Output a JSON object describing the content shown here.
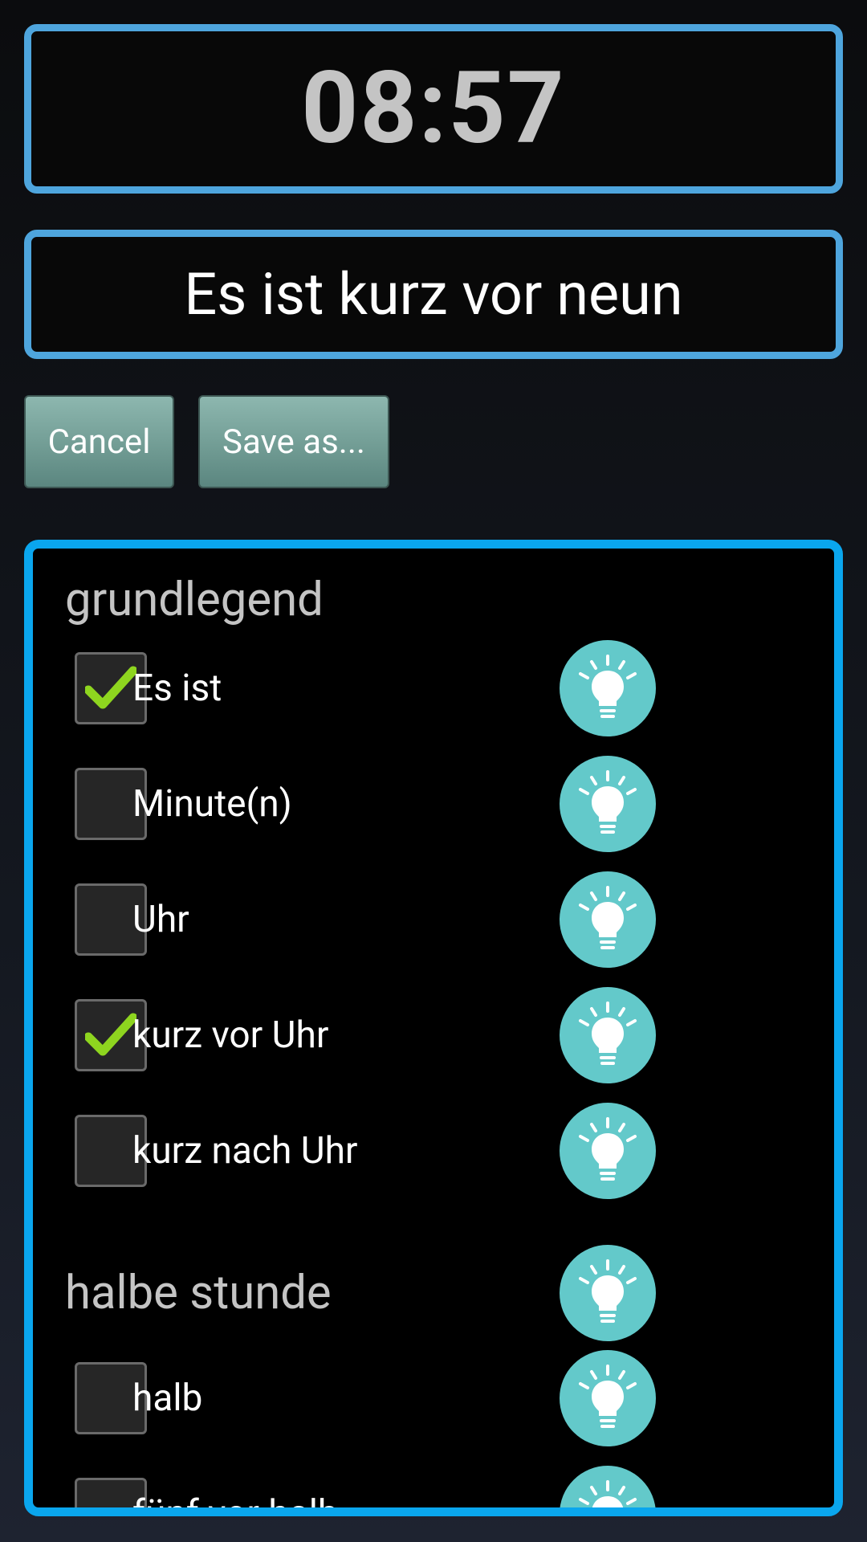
{
  "clock": {
    "time": "08:57"
  },
  "phrase": {
    "text": "Es ist kurz vor neun"
  },
  "buttons": {
    "cancel": "Cancel",
    "save_as": "Save as..."
  },
  "sections": [
    {
      "title": "grundlegend",
      "items": [
        {
          "label": "Es ist",
          "checked": true,
          "icon": "lightbulb-icon"
        },
        {
          "label": "Minute(n)",
          "checked": false,
          "icon": "lightbulb-icon"
        },
        {
          "label": "Uhr",
          "checked": false,
          "icon": "lightbulb-icon"
        },
        {
          "label": "kurz vor Uhr",
          "checked": true,
          "icon": "lightbulb-icon"
        },
        {
          "label": "kurz nach Uhr",
          "checked": false,
          "icon": "lightbulb-icon"
        }
      ]
    },
    {
      "title": "halbe stunde",
      "title_icon": "lightbulb-icon",
      "items": [
        {
          "label": "halb",
          "checked": false,
          "icon": "lightbulb-icon"
        },
        {
          "label": "fünf vor halb",
          "checked": false,
          "icon": "lightbulb-icon"
        }
      ]
    }
  ],
  "colors": {
    "frame_border": "#4ea5dd",
    "list_border": "#0aa6ee",
    "bulb": "#63c9ca",
    "checkmark": "#8ed51f",
    "button": "#7ea89f"
  }
}
